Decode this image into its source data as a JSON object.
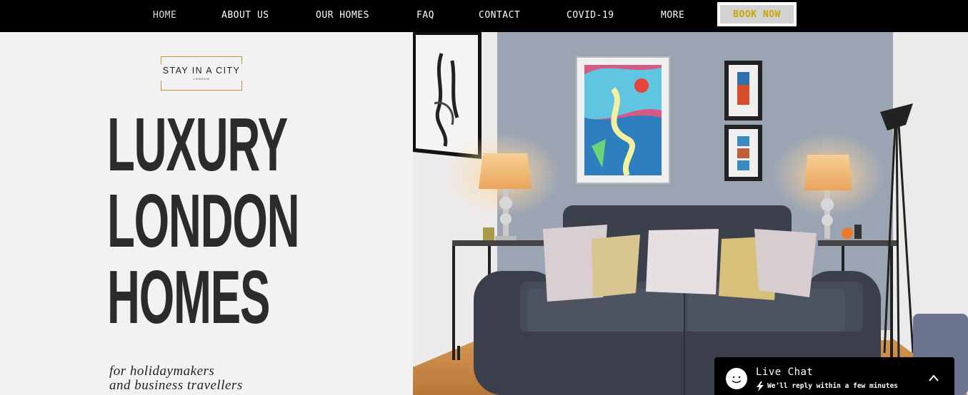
{
  "nav": {
    "items": [
      {
        "label": "HOME",
        "active": true
      },
      {
        "label": "ABOUT US"
      },
      {
        "label": "OUR HOMES"
      },
      {
        "label": "FAQ"
      },
      {
        "label": "CONTACT"
      },
      {
        "label": "COVID-19"
      },
      {
        "label": "MORE"
      }
    ],
    "book_now": "BOOK NOW"
  },
  "logo": {
    "name": "STAY IN A CITY",
    "city": "LONDON"
  },
  "hero": {
    "headline": [
      "LUXURY",
      "LONDON",
      "HOMES"
    ],
    "tagline": [
      "for holidaymakers",
      "and business travellers"
    ]
  },
  "live_chat": {
    "title": "Live Chat",
    "subtitle": "We’ll reply within a few minutes"
  },
  "colors": {
    "nav_bg": "#000000",
    "accent_gold": "#c9a700",
    "headline": "#2b2b2b",
    "wall": "#9aa4b3",
    "sofa": "#3a3f4b"
  },
  "icons": [
    "smiley-icon",
    "lightning-icon",
    "chevron-up-icon"
  ]
}
